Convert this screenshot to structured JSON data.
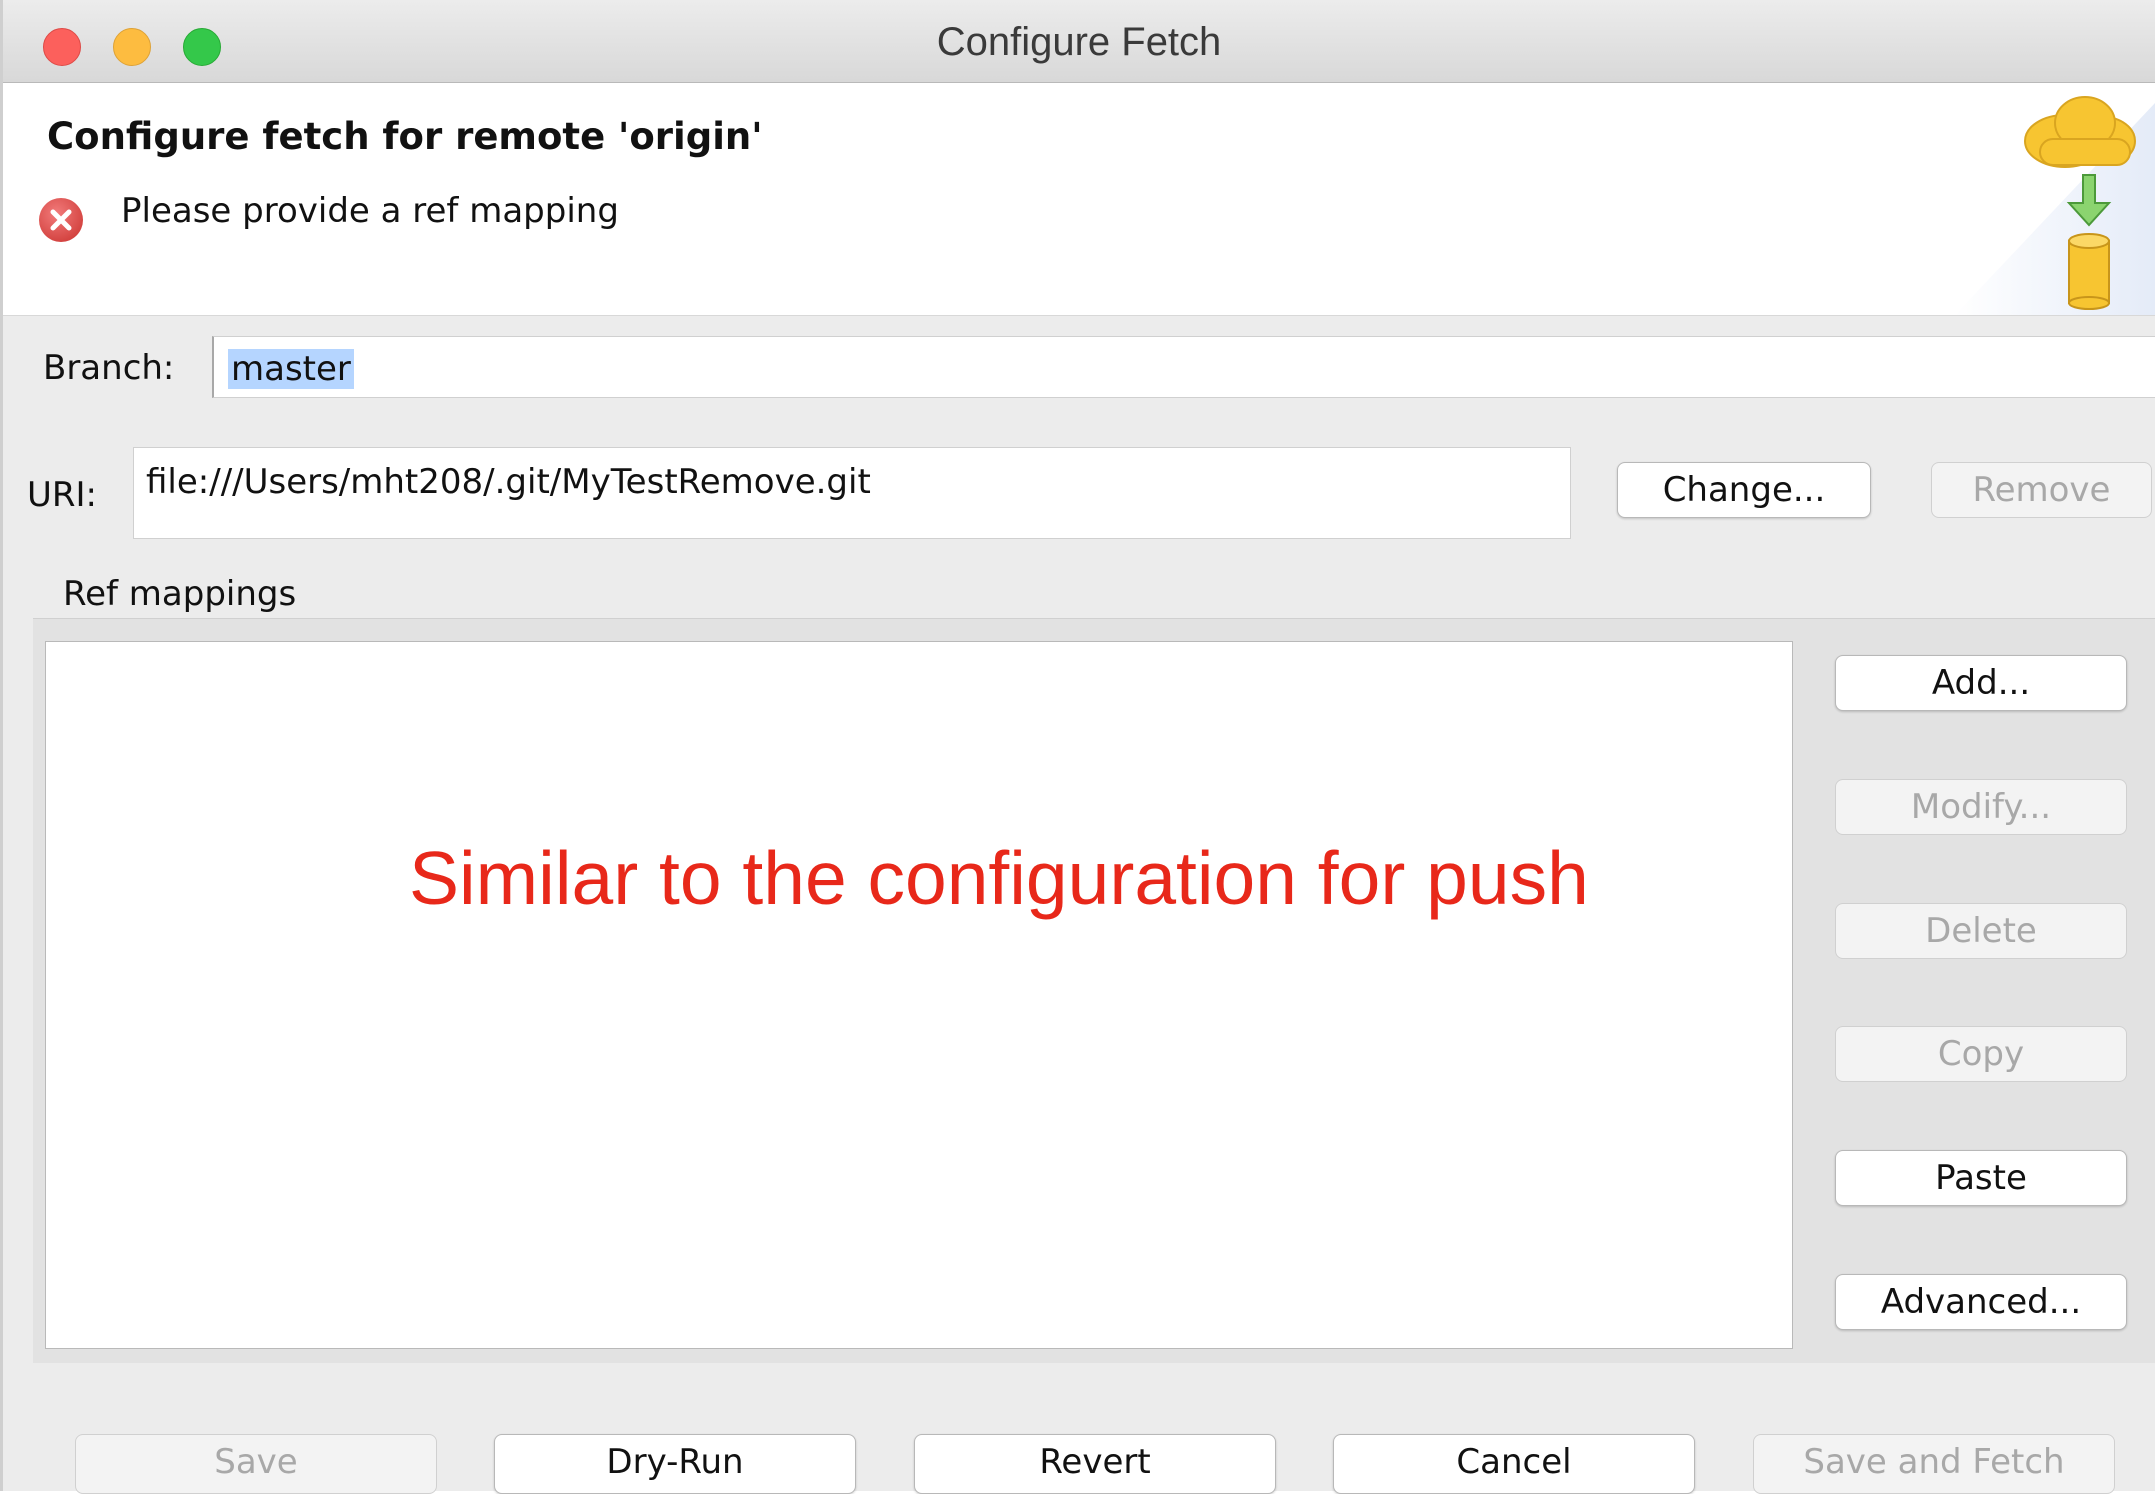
{
  "window": {
    "title": "Configure Fetch"
  },
  "header": {
    "title": "Configure fetch for remote 'origin'",
    "error_message": "Please provide a ref mapping",
    "art_icon": "cloud-fetch-database-icon"
  },
  "branch": {
    "label": "Branch:",
    "value": "master"
  },
  "uri": {
    "label": "URI:",
    "value": "file:///Users/mht208/.git/MyTestRemove.git",
    "change_label": "Change...",
    "remove_label": "Remove"
  },
  "ref_mappings": {
    "label": "Ref mappings",
    "buttons": [
      {
        "label": "Add...",
        "enabled": true
      },
      {
        "label": "Modify...",
        "enabled": false
      },
      {
        "label": "Delete",
        "enabled": false
      },
      {
        "label": "Copy",
        "enabled": false
      },
      {
        "label": "Paste",
        "enabled": true
      },
      {
        "label": "Advanced...",
        "enabled": true
      }
    ]
  },
  "annotation": {
    "text": "Similar to the configuration for push",
    "color": "#e8281a"
  },
  "footer": {
    "buttons": [
      {
        "label": "Save",
        "enabled": false
      },
      {
        "label": "Dry-Run",
        "enabled": true
      },
      {
        "label": "Revert",
        "enabled": true
      },
      {
        "label": "Cancel",
        "enabled": true
      },
      {
        "label": "Save and Fetch",
        "enabled": false
      }
    ]
  }
}
